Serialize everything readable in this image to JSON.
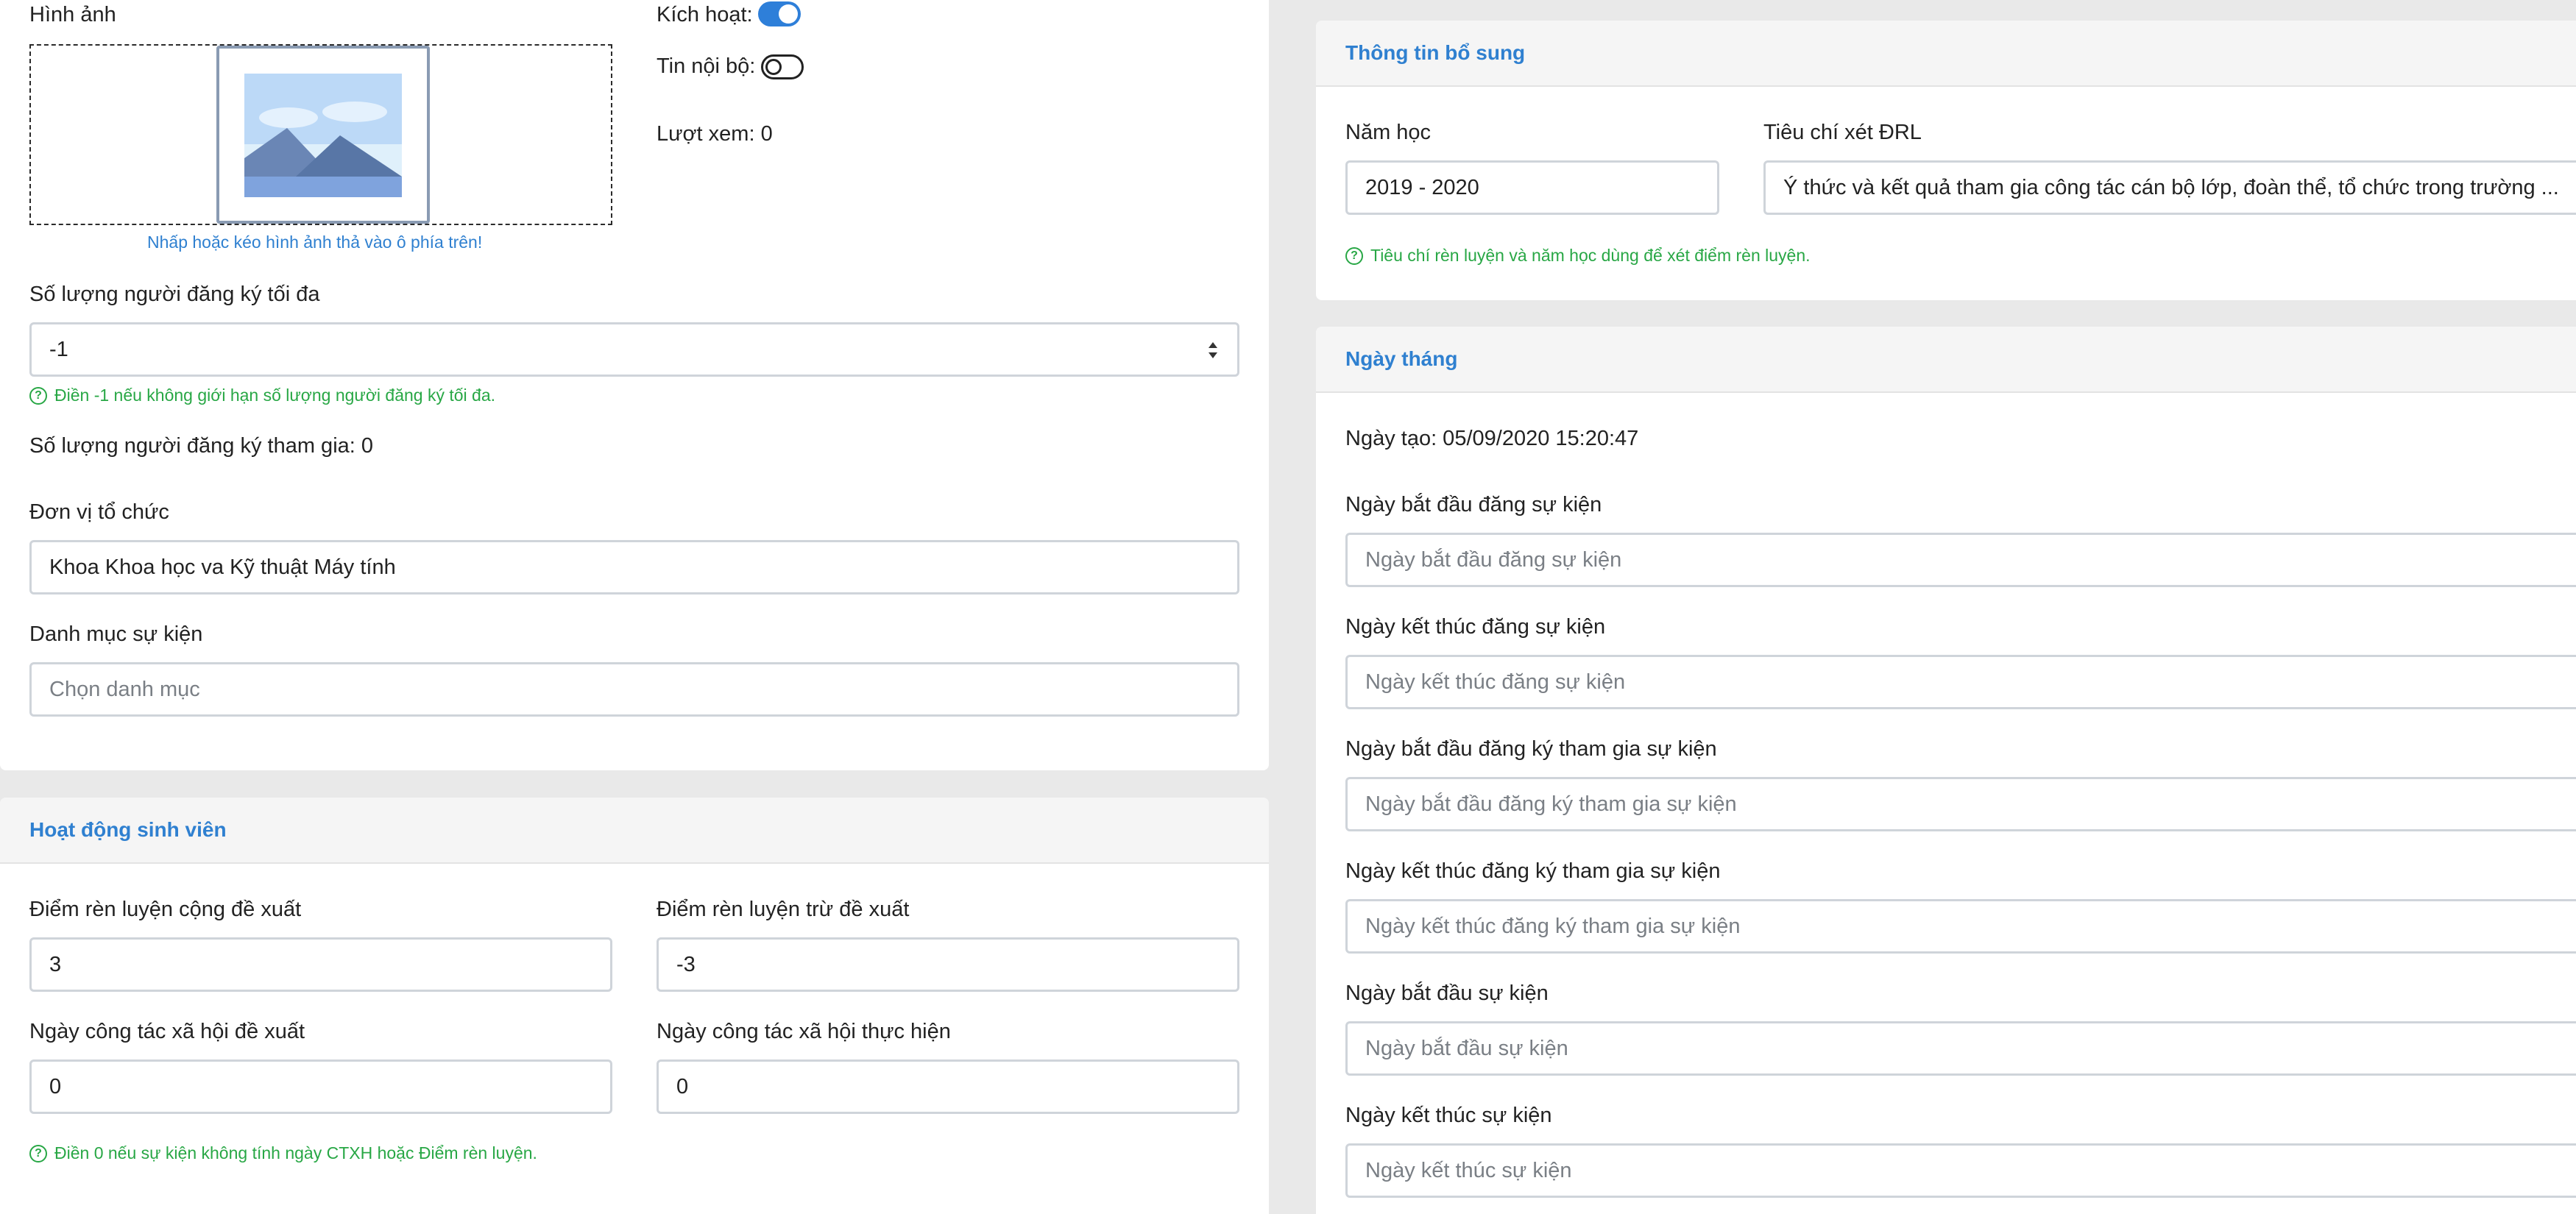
{
  "left_panel": {
    "image_label": "Hình ảnh",
    "dropzone_hint": "Nhấp hoặc kéo hình ảnh thả vào ô phía trên!",
    "active_label": "Kích hoạt:",
    "active_on": true,
    "internal_label": "Tin nội bộ:",
    "internal_on": false,
    "views_label": "Lượt xem: 0",
    "max_reg_label": "Số lượng người đăng ký tối đa",
    "max_reg_value": "-1",
    "max_reg_help": "Điền -1 nếu không giới hạn số lượng người đăng ký tối đa.",
    "participants_label": "Số lượng người đăng ký tham gia: 0",
    "org_label": "Đơn vị tổ chức",
    "org_value": "Khoa Khoa học va Kỹ thuật Máy tính",
    "category_label": "Danh mục sự kiện",
    "category_placeholder": "Chọn danh mục"
  },
  "student_panel": {
    "title": "Hoạt động sinh viên",
    "plus_label": "Điểm rèn luyện cộng đề xuất",
    "plus_value": "3",
    "minus_label": "Điểm rèn luyện trừ đề xuất",
    "minus_value": "-3",
    "ctxh_proposed_label": "Ngày công tác xã hội đề xuất",
    "ctxh_proposed_value": "0",
    "ctxh_done_label": "Ngày công tác xã hội thực hiện",
    "ctxh_done_value": "0",
    "help": "Điền 0 nếu sự kiện không tính ngày CTXH hoặc Điểm rèn luyện."
  },
  "extra_panel": {
    "title": "Thông tin bổ sung",
    "year_label": "Năm học",
    "year_value": "2019 - 2020",
    "criteria_label": "Tiêu chí xét ĐRL",
    "criteria_value": "Ý thức và kết quả tham gia công tác cán bộ lớp, đoàn thể, tổ chức trong trường ...",
    "help": "Tiêu chí rèn luyện và năm học dùng để xét điểm rèn luyện."
  },
  "dates_panel": {
    "title": "Ngày tháng",
    "created": "Ngày tạo: 05/09/2020 15:20:47",
    "fields": [
      {
        "label": "Ngày bắt đầu đăng sự kiện",
        "placeholder": "Ngày bắt đầu đăng sự kiện"
      },
      {
        "label": "Ngày kết thúc đăng sự kiện",
        "placeholder": "Ngày kết thúc đăng sự kiện"
      },
      {
        "label": "Ngày bắt đầu đăng ký tham gia sự kiện",
        "placeholder": "Ngày bắt đầu đăng ký tham gia sự kiện"
      },
      {
        "label": "Ngày kết thúc đăng ký tham gia sự kiện",
        "placeholder": "Ngày kết thúc đăng ký tham gia sự kiện"
      },
      {
        "label": "Ngày bắt đầu sự kiện",
        "placeholder": "Ngày bắt đầu sự kiện"
      },
      {
        "label": "Ngày kết thúc sự kiện",
        "placeholder": "Ngày kết thúc sự kiện"
      }
    ]
  },
  "colors": {
    "accent": "#2f80d0",
    "help_green": "#28a745",
    "toggle_on": "#2e7fd9"
  },
  "icons": {
    "help": "question-circle-icon",
    "image_placeholder": "landscape-image-icon"
  }
}
